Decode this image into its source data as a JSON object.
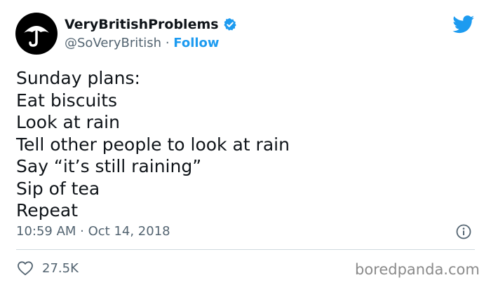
{
  "author": {
    "display_name": "VeryBritishProblems",
    "handle": "@SoVeryBritish",
    "separator": "·",
    "follow_label": "Follow",
    "verified": true
  },
  "tweet": {
    "lines": [
      "Sunday plans:",
      "Eat biscuits",
      "Look at rain",
      "Tell other people to look at rain",
      "Say “it’s still raining”",
      "Sip of tea",
      "Repeat"
    ],
    "timestamp": "10:59 AM · Oct 14, 2018",
    "likes": "27.5K"
  },
  "icons": {
    "avatar": "umbrella-icon",
    "verified": "verified-badge-icon",
    "brand": "twitter-bird-icon",
    "info": "info-icon",
    "like": "heart-icon"
  },
  "watermark": "boredpanda.com",
  "colors": {
    "accent": "#1d9bf0",
    "text": "#0f1419",
    "secondary": "#536471",
    "divider": "#cfd9de",
    "watermark": "#8a8a8a"
  }
}
